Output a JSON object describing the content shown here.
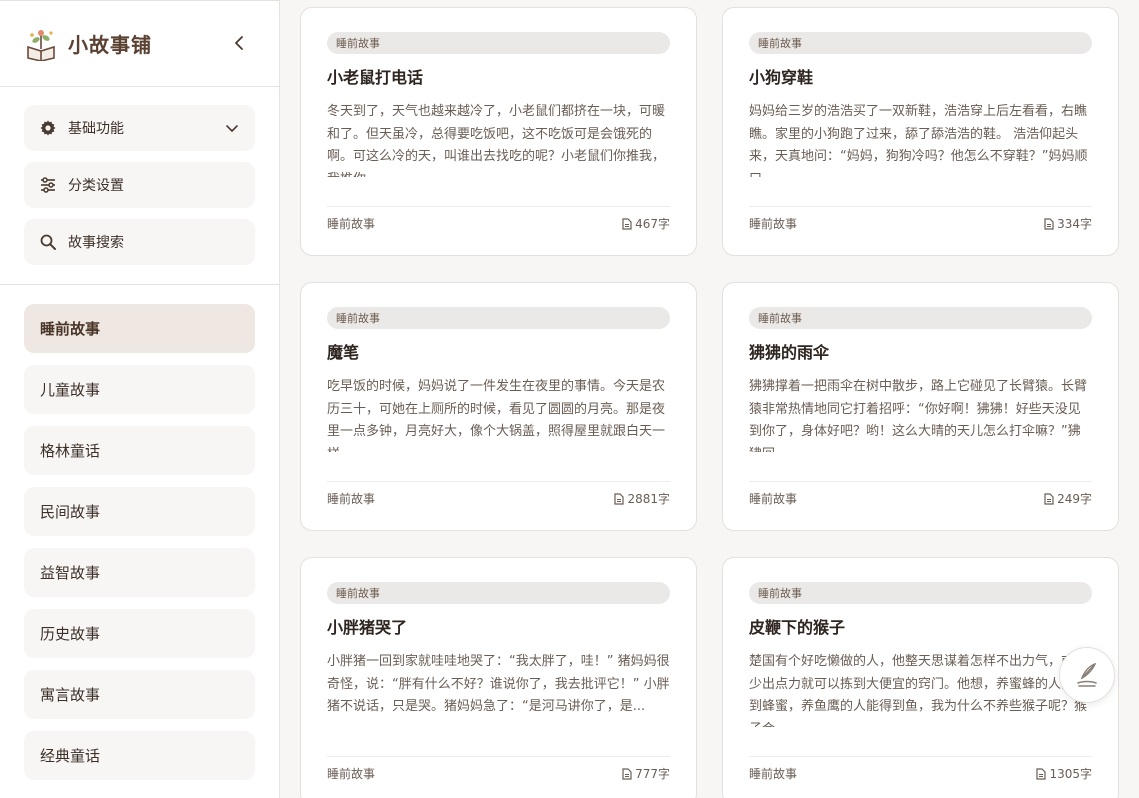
{
  "brand": {
    "title": "小故事铺"
  },
  "menu": [
    {
      "label": "基础功能",
      "icon": "gear-icon"
    },
    {
      "label": "分类设置",
      "icon": "sliders-icon"
    },
    {
      "label": "故事搜索",
      "icon": "search-icon"
    }
  ],
  "categories": [
    "睡前故事",
    "儿童故事",
    "格林童话",
    "民间故事",
    "益智故事",
    "历史故事",
    "寓言故事",
    "经典童话"
  ],
  "active_category": "睡前故事",
  "stories": [
    {
      "tag": "睡前故事",
      "title": "小老鼠打电话",
      "excerpt": "冬天到了，天气也越来越冷了，小老鼠们都挤在一块，可暖和了。但天虽冷，总得要吃饭吧，这不吃饭可是会饿死的啊。可这么冷的天，叫谁出去找吃的呢？小老鼠们你推我，我推你...",
      "category": "睡前故事",
      "words": "467字"
    },
    {
      "tag": "睡前故事",
      "title": "小狗穿鞋",
      "excerpt": "妈妈给三岁的浩浩买了一双新鞋，浩浩穿上后左看看，右瞧瞧。家里的小狗跑了过来，舔了舔浩浩的鞋。 浩浩仰起头来，天真地问：“妈妈，狗狗冷吗？他怎么不穿鞋？”妈妈顺口...",
      "category": "睡前故事",
      "words": "334字"
    },
    {
      "tag": "睡前故事",
      "title": "魔笔",
      "excerpt": "吃早饭的时候，妈妈说了一件发生在夜里的事情。今天是农历三十，可她在上厕所的时候，看见了圆圆的月亮。那是夜里一点多钟，月亮好大，像个大锅盖，照得屋里就跟白天一样。...",
      "category": "睡前故事",
      "words": "2881字"
    },
    {
      "tag": "睡前故事",
      "title": "狒狒的雨伞",
      "excerpt": "狒狒撑着一把雨伞在树中散步，路上它碰见了长臂猿。长臂猿非常热情地同它打着招呼：“你好啊！狒狒！好些天没见到你了，身体好吧？哟！这么大晴的天儿怎么打伞嘛？”狒狒回...",
      "category": "睡前故事",
      "words": "249字"
    },
    {
      "tag": "睡前故事",
      "title": "小胖猪哭了",
      "excerpt": "小胖猪一回到家就哇哇地哭了：“我太胖了，哇！” 猪妈妈很奇怪，说：“胖有什么不好？谁说你了，我去批评它！” 小胖猪不说话，只是哭。猪妈妈急了：“是河马讲你了，是...",
      "category": "睡前故事",
      "words": "777字"
    },
    {
      "tag": "睡前故事",
      "title": "皮鞭下的猴子",
      "excerpt": "楚国有个好吃懒做的人，他整天思谋着怎样不出力气，或者少出点力就可以拣到大便宜的窍门。他想，养蜜蜂的人能得到蜂蜜，养鱼鹰的人能得到鱼，我为什么不养些猴子呢？猴子会...",
      "category": "睡前故事",
      "words": "1305字"
    }
  ],
  "fab": {
    "icon": "quill-pen-icon"
  }
}
